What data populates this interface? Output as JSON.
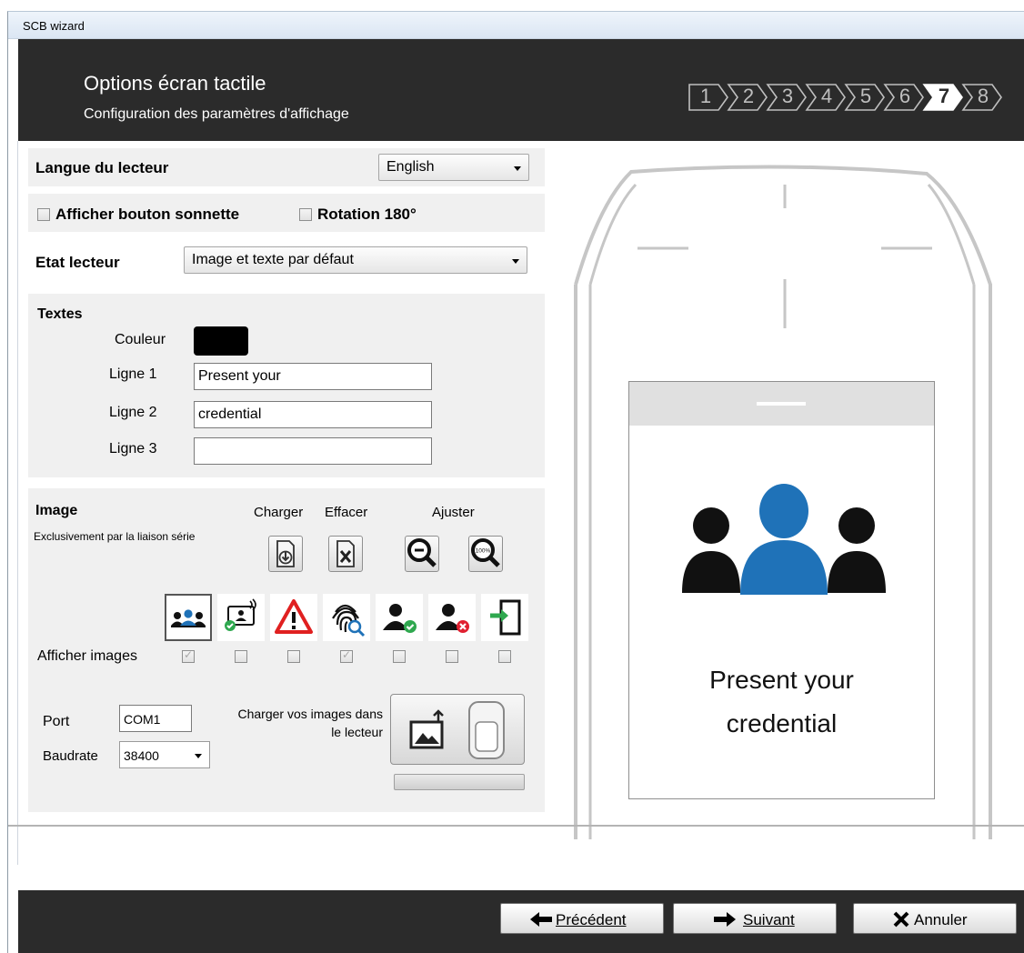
{
  "window": {
    "title": "SCB wizard"
  },
  "header": {
    "title": "Options écran tactile",
    "subtitle": "Configuration des paramètres d'affichage",
    "steps": [
      "1",
      "2",
      "3",
      "4",
      "5",
      "6",
      "7",
      "8"
    ],
    "current_step": "7"
  },
  "reader_language": {
    "label": "Langue du lecteur",
    "value": "English"
  },
  "options": {
    "doorbell": {
      "label": "Afficher bouton sonnette",
      "checked": false
    },
    "rotation": {
      "label": "Rotation 180°",
      "checked": false
    }
  },
  "reader_state": {
    "label": "Etat lecteur",
    "value": "Image et texte par défaut"
  },
  "texts": {
    "heading": "Textes",
    "color_label": "Couleur",
    "color_value": "#000000",
    "line1_label": "Ligne 1",
    "line1_value": "Present your",
    "line2_label": "Ligne 2",
    "line2_value": "credential",
    "line3_label": "Ligne 3",
    "line3_value": ""
  },
  "image": {
    "heading": "Image",
    "note": "Exclusivement par la liaison série",
    "load_label": "Charger",
    "clear_label": "Effacer",
    "adjust_label": "Ajuster",
    "show_images_label": "Afficher images",
    "icons": [
      {
        "icon": "group-users-icon",
        "selected": true,
        "show": true
      },
      {
        "icon": "badge-ok-icon",
        "selected": false,
        "show": false
      },
      {
        "icon": "warning-icon",
        "selected": false,
        "show": false
      },
      {
        "icon": "fingerprint-icon",
        "selected": false,
        "show": true
      },
      {
        "icon": "user-granted-icon",
        "selected": false,
        "show": false
      },
      {
        "icon": "user-denied-icon",
        "selected": false,
        "show": false
      },
      {
        "icon": "door-enter-icon",
        "selected": false,
        "show": false
      }
    ]
  },
  "serial": {
    "port_label": "Port",
    "port_value": "COM1",
    "baud_label": "Baudrate",
    "baud_value": "38400",
    "upload_label": "Charger vos images dans le lecteur",
    "upload_progress": 0
  },
  "preview": {
    "line1": "Present your",
    "line2": "credential",
    "accent": "#1f72b8"
  },
  "footer": {
    "prev": "Précédent",
    "next": "Suivant",
    "cancel": "Annuler"
  }
}
